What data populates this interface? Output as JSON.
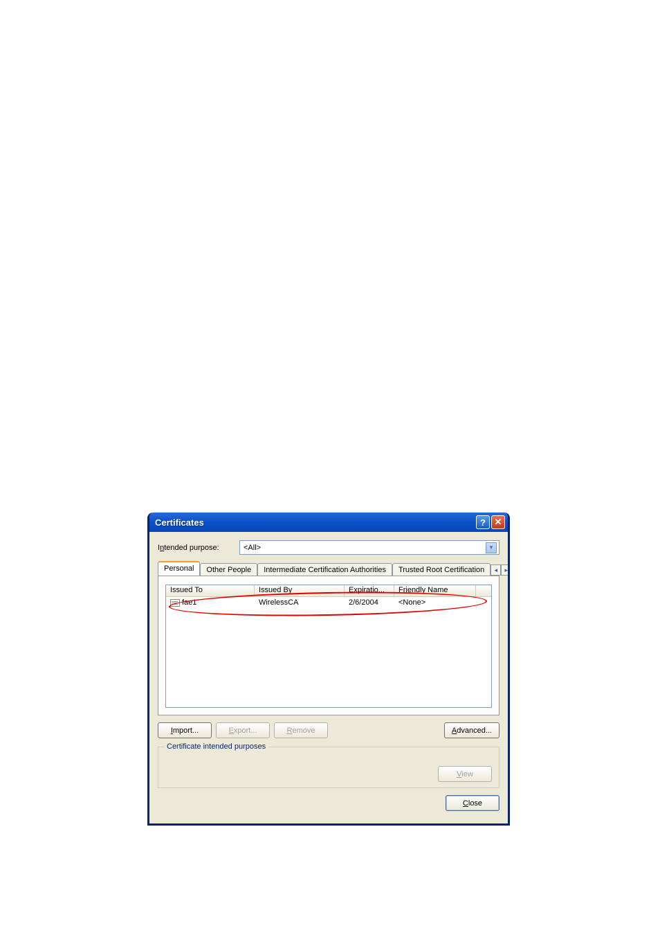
{
  "title": "Certificates",
  "purpose_label_pre": "I",
  "purpose_label_ul": "n",
  "purpose_label_post": "tended purpose:",
  "purpose_value": "<All>",
  "tabs": {
    "personal": "Personal",
    "other_people": "Other People",
    "intermediate": "Intermediate Certification Authorities",
    "trusted_root": "Trusted Root Certification"
  },
  "columns": {
    "issued_to": "Issued To",
    "issued_by": "Issued By",
    "expiration": "Expiratio...",
    "friendly_name": "Friendly Name"
  },
  "rows": [
    {
      "issued_to": "fae1",
      "issued_by": "WirelessCA",
      "expiration": "2/6/2004",
      "friendly_name": "<None>"
    }
  ],
  "buttons": {
    "import_ul": "I",
    "import_rest": "mport...",
    "export_ul": "E",
    "export_rest": "xport...",
    "remove_ul": "R",
    "remove_rest": "emove",
    "advanced_ul": "A",
    "advanced_rest": "dvanced...",
    "view_ul": "V",
    "view_rest": "iew",
    "close_ul": "C",
    "close_rest": "lose"
  },
  "fieldset_legend": "Certificate intended purposes"
}
